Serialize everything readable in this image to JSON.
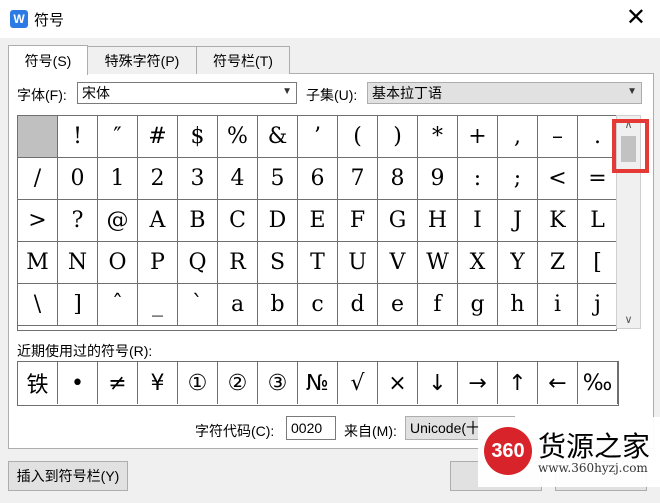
{
  "window": {
    "title": "符号",
    "close_glyph": "✕",
    "app_icon": "W"
  },
  "tabs": [
    {
      "label": "符号(S)",
      "active": true
    },
    {
      "label": "特殊字符(P)",
      "active": false
    },
    {
      "label": "符号栏(T)",
      "active": false
    }
  ],
  "font": {
    "label": "字体(F):",
    "value": "宋体"
  },
  "subset": {
    "label": "子集(U):",
    "value": "基本拉丁语"
  },
  "symbols": [
    [
      " ",
      "!",
      "″",
      "#",
      "$",
      "%",
      "&",
      "’",
      "(",
      ")",
      "*",
      "+",
      ",",
      "–",
      "."
    ],
    [
      "/",
      "0",
      "1",
      "2",
      "3",
      "4",
      "5",
      "6",
      "7",
      "8",
      "9",
      ":",
      ";",
      "<",
      "="
    ],
    [
      ">",
      "?",
      "@",
      "A",
      "B",
      "C",
      "D",
      "E",
      "F",
      "G",
      "H",
      "I",
      "J",
      "K",
      "L"
    ],
    [
      "M",
      "N",
      "O",
      "P",
      "Q",
      "R",
      "S",
      "T",
      "U",
      "V",
      "W",
      "X",
      "Y",
      "Z",
      "["
    ],
    [
      "\\",
      "]",
      "ˆ",
      "_",
      "`",
      "a",
      "b",
      "c",
      "d",
      "e",
      "f",
      "g",
      "h",
      "i",
      "j"
    ]
  ],
  "recent": {
    "label": "近期使用过的符号(R):",
    "items": [
      "铁",
      "•",
      "≠",
      "¥",
      "①",
      "②",
      "③",
      "№",
      "√",
      "×",
      "↓",
      "→",
      "↑",
      "←",
      "‰"
    ]
  },
  "char_code": {
    "label": "字符代码(C):",
    "value": "0020"
  },
  "from": {
    "label": "来自(M):",
    "value": "Unicode(十"
  },
  "buttons": {
    "insert_to_bar": "插入到符号栏(Y)"
  },
  "watermark": {
    "badge": "360",
    "name": "货源之家",
    "url": "www.360hyzj.com"
  },
  "icons": {
    "scroll_up": "chevron-up-icon",
    "scroll_down": "chevron-down-icon",
    "dropdown": "chevron-down-icon"
  },
  "colors": {
    "highlight": "#e53935",
    "watermark_red": "#d8232a",
    "selected_cell": "#c0c0c0"
  }
}
